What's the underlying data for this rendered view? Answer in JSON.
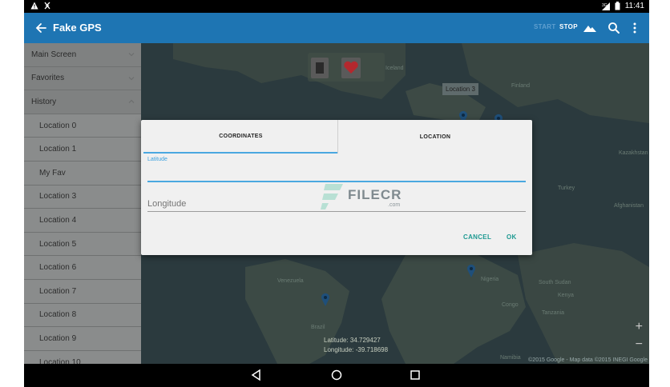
{
  "status_bar": {
    "time": "11:41"
  },
  "app_bar": {
    "title": "Fake GPS",
    "start_label": "START",
    "stop_label": "STOP"
  },
  "drawer": {
    "items": [
      {
        "label": "Main Screen",
        "child": false
      },
      {
        "label": "Favorites",
        "child": false
      },
      {
        "label": "History",
        "child": false,
        "expanded": true
      },
      {
        "label": "Location 0",
        "child": true
      },
      {
        "label": "Location 1",
        "child": true
      },
      {
        "label": "My Fav",
        "child": true
      },
      {
        "label": "Location 3",
        "child": true
      },
      {
        "label": "Location 4",
        "child": true
      },
      {
        "label": "Location 5",
        "child": true
      },
      {
        "label": "Location 6",
        "child": true
      },
      {
        "label": "Location 7",
        "child": true
      },
      {
        "label": "Location 8",
        "child": true
      },
      {
        "label": "Location 9",
        "child": true
      },
      {
        "label": "Location 10",
        "child": true
      }
    ]
  },
  "map": {
    "marker_label": "Location 3",
    "labels": {
      "iceland": "Iceland",
      "finland": "Finland",
      "kazakhstan": "Kazakhstan",
      "turkey": "Turkey",
      "afghanistan": "Afghanistan",
      "venezuela": "Venezuela",
      "brazil": "Brazil",
      "nigeria": "Nigeria",
      "south_sudan": "South Sudan",
      "kenya": "Kenya",
      "congo": "Congo",
      "tanzania": "Tanzania",
      "namibia": "Namibia"
    },
    "latitude_text": "Latitude:  34.729427",
    "longitude_text": "Longitude: -39.718698",
    "attribution": "©2015 Google - Map data ©2015 INEGI Google"
  },
  "dialog": {
    "tab_coordinates": "COORDINATES",
    "tab_location": "LOCATION",
    "latitude_label": "Latitude",
    "latitude_value": "",
    "longitude_placeholder": "Longitude",
    "cancel_label": "CANCEL",
    "ok_label": "OK"
  },
  "watermark": {
    "text": "FILECR",
    "sub": ".com"
  },
  "colors": {
    "app_bar": "#1e75b3",
    "accent_blue": "#4aa8e0",
    "dialog_button": "#1f9a92",
    "drawer_bg": "#7f8181",
    "map_bg": "#2b3a3e"
  }
}
